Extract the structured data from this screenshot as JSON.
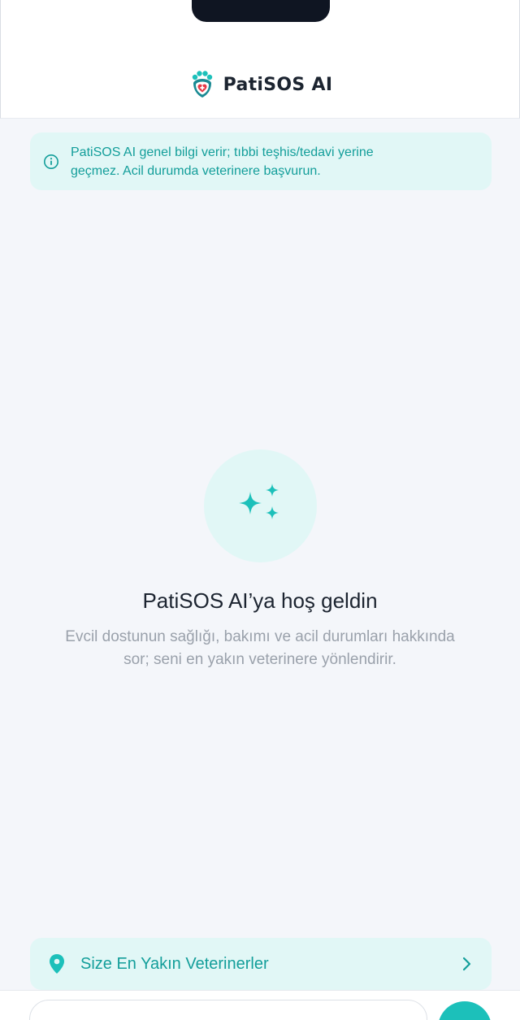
{
  "header": {
    "brand_name": "PatiSOS AI",
    "logo_icon": "paw-shield-heart-icon"
  },
  "disclaimer": {
    "icon": "info-circle-icon",
    "text_line1": "PatiSOS AI genel bilgi verir; tıbbi teşhis/tedavi yerine",
    "text_line2": "geçmez. Acil durumda veterinere başvurun."
  },
  "welcome": {
    "icon": "sparkles-icon",
    "title": "PatiSOS AI’ya hoş geldin",
    "subtitle_line1": "Evcil dostunun sağlığı, bakımı ve acil durumları hakkında",
    "subtitle_line2": "sor; seni en yakın veterinere yönlendirir."
  },
  "nearby_vets": {
    "icon": "map-pin-icon",
    "label": "Size En Yakın Veterinerler",
    "chevron": "chevron-right-icon"
  },
  "composer": {
    "input_value": "",
    "send_icon": "send-icon"
  },
  "colors": {
    "accent": "#1cc0ba",
    "accent_text": "#139e9a",
    "accent_bg": "#e1f7f6",
    "brand_red": "#e53946",
    "page_bg": "#f4f6fa"
  }
}
